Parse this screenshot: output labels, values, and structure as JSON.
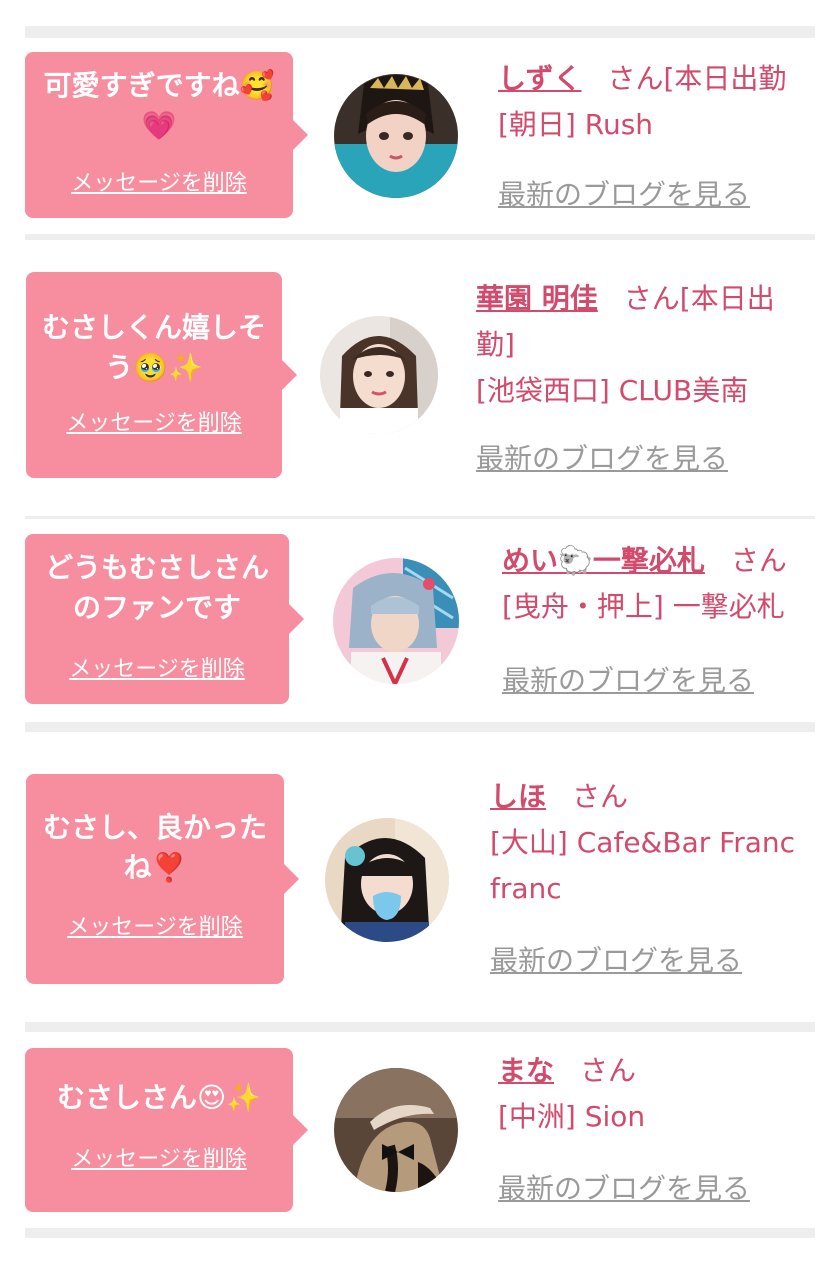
{
  "cards": [
    {
      "message": "可愛すぎですね🥰💗",
      "message_lines": [
        "可愛すぎですね🥰",
        "💗"
      ],
      "delete_label": "メッセージを削除",
      "name": "しずく",
      "honorific": "さん",
      "status": "[本日出勤",
      "shop": "[朝日] Rush",
      "blog_label": "最新のブログを見る"
    },
    {
      "message": "むさしくん嬉しそう🥹✨",
      "message_lines": [
        "むさしくん嬉しそ",
        "う🥹✨"
      ],
      "delete_label": "メッセージを削除",
      "name": "華園 明佳",
      "honorific": "さん",
      "status": "[本日出",
      "status_cont": "勤]",
      "shop": "[池袋西口] CLUB美南",
      "blog_label": "最新のブログを見る"
    },
    {
      "message": "どうもむさしさんのファンです",
      "message_lines": [
        "どうもむさしさん",
        "のファンです"
      ],
      "delete_label": "メッセージを削除",
      "name": "めい🐑一撃必札",
      "honorific": "さん",
      "shop": "[曳舟・押上] 一撃必札",
      "blog_label": "最新のブログを見る"
    },
    {
      "message": "むさし、良かったね❣️",
      "message_lines": [
        "むさし、良かった",
        "ね❣️"
      ],
      "delete_label": "メッセージを削除",
      "name": "しほ",
      "honorific": "さん",
      "shop": "[大山] Cafe&Bar Franc",
      "shop_cont": "franc",
      "blog_label": "最新のブログを見る"
    },
    {
      "message": "むさしさん😍✨",
      "message_lines": [
        "むさしさん😍✨"
      ],
      "delete_label": "メッセージを削除",
      "name": "まな",
      "honorific": "さん",
      "shop": "[中洲] Sion",
      "blog_label": "最新のブログを見る"
    }
  ],
  "colors": {
    "bubble": "#f68ea0",
    "name_text": "#d24a6c",
    "link_grey": "#9a9a9a",
    "divider": "#eeeeee"
  }
}
